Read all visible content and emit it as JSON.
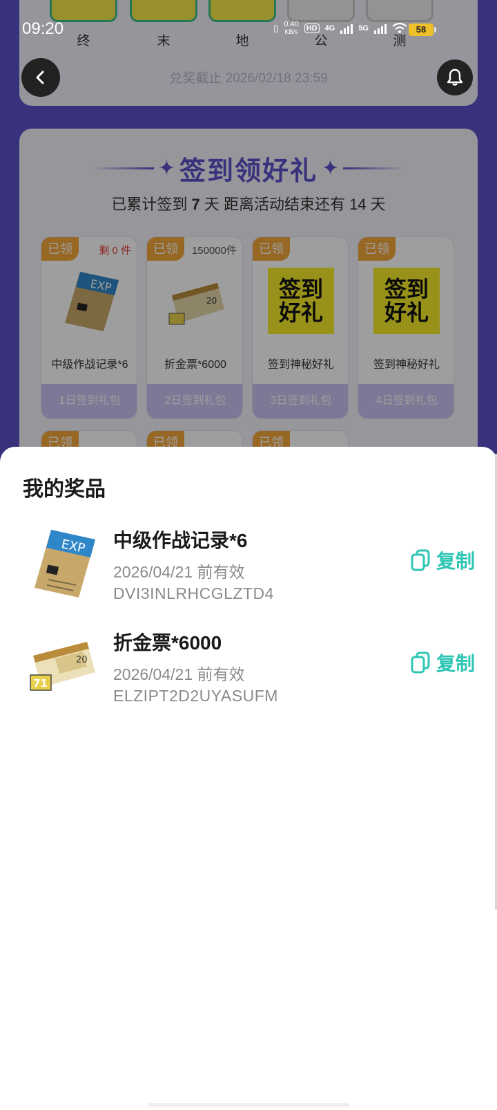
{
  "status_bar": {
    "time": "09:20",
    "net_speed": "0.40",
    "net_unit": "KB/s",
    "hd": "HD",
    "sim1": "4G",
    "sim2": "5G",
    "battery": "58"
  },
  "top_card": {
    "tile_labels": [
      "终",
      "末",
      "地",
      "公",
      "测"
    ],
    "deadline": "兑奖截止 2026/02/18 23:59"
  },
  "sign_in": {
    "title": "签到领好礼",
    "sub_prefix": "已累计签到",
    "days": "7",
    "sub_mid": "天  距离活动结束还有 14 天",
    "gifts": [
      {
        "tag": "已领",
        "stock": "剩 0 件",
        "name": "中级作战记录*6",
        "footer": "1日签到礼包"
      },
      {
        "tag": "已领",
        "stock": "150000件",
        "name": "折金票*6000",
        "footer": "2日签到礼包"
      },
      {
        "tag": "已领",
        "stock": "",
        "name": "签到神秘好礼",
        "footer": "3日签到礼包",
        "art": "签到\n好礼"
      },
      {
        "tag": "已领",
        "stock": "",
        "name": "签到神秘好礼",
        "footer": "4日签到礼包",
        "art": "签到\n好礼"
      }
    ],
    "row2_tags": [
      "已领",
      "已领",
      "已领"
    ]
  },
  "sheet": {
    "title": "我的奖品",
    "prizes": [
      {
        "name": "中级作战记录*6",
        "valid": "2026/04/21 前有效",
        "code": "DVI3INLRHCGLZTD4",
        "copy_label": "复制"
      },
      {
        "name": "折金票*6000",
        "valid": "2026/04/21 前有效",
        "code": "ELZIPT2D2UYASUFM",
        "copy_label": "复制"
      }
    ]
  },
  "colors": {
    "brand_purple": "#5b4fc9",
    "copy_teal": "#2ec6b4",
    "tag_orange": "#f4a73a"
  }
}
